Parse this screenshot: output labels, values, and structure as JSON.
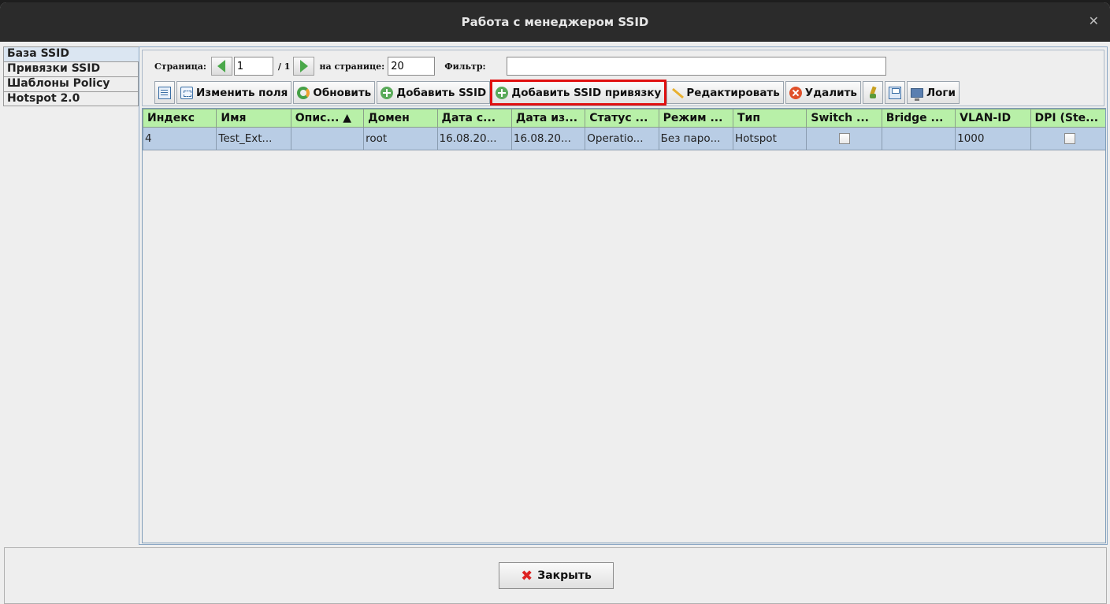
{
  "window": {
    "title": "Работа с менеджером SSID"
  },
  "sidebar": {
    "items": [
      {
        "label": "База SSID"
      },
      {
        "label": "Привязки SSID"
      },
      {
        "label": "Шаблоны Policy"
      },
      {
        "label": "Hotspot 2.0"
      }
    ]
  },
  "pager": {
    "page_label": "Страница:",
    "page_value": "1",
    "page_total": "/ 1",
    "per_page_label": "на странице:",
    "per_page_value": "20",
    "filter_label": "Фильтр:",
    "filter_value": ""
  },
  "toolbar": {
    "edit_fields": "Изменить поля",
    "refresh": "Обновить",
    "add_ssid": "Добавить SSID",
    "add_binding": "Добавить SSID привязку",
    "edit": "Редактировать",
    "delete": "Удалить",
    "logs": "Логи"
  },
  "table": {
    "columns": [
      "Индекс",
      "Имя",
      "Опис... ▲",
      "Домен",
      "Дата с...",
      "Дата из...",
      "Статус ...",
      "Режим ...",
      "Тип",
      "Switch ...",
      "Bridge ...",
      "VLAN-ID",
      "DPI (Ste..."
    ],
    "rows": [
      {
        "index": "4",
        "name": "Test_Ext...",
        "description": "",
        "domain": "root",
        "date_created": "16.08.20...",
        "date_modified": "16.08.20...",
        "status": "Operatio...",
        "mode": "Без паро...",
        "type": "Hotspot",
        "switch": false,
        "bridge": "",
        "vlan_id": "1000",
        "dpi": false
      }
    ]
  },
  "footer": {
    "close_label": "Закрыть"
  },
  "colors": {
    "header_bg": "#b8f0a8",
    "row_selected_bg": "#b9cde5",
    "highlight_outline": "#e01010"
  }
}
